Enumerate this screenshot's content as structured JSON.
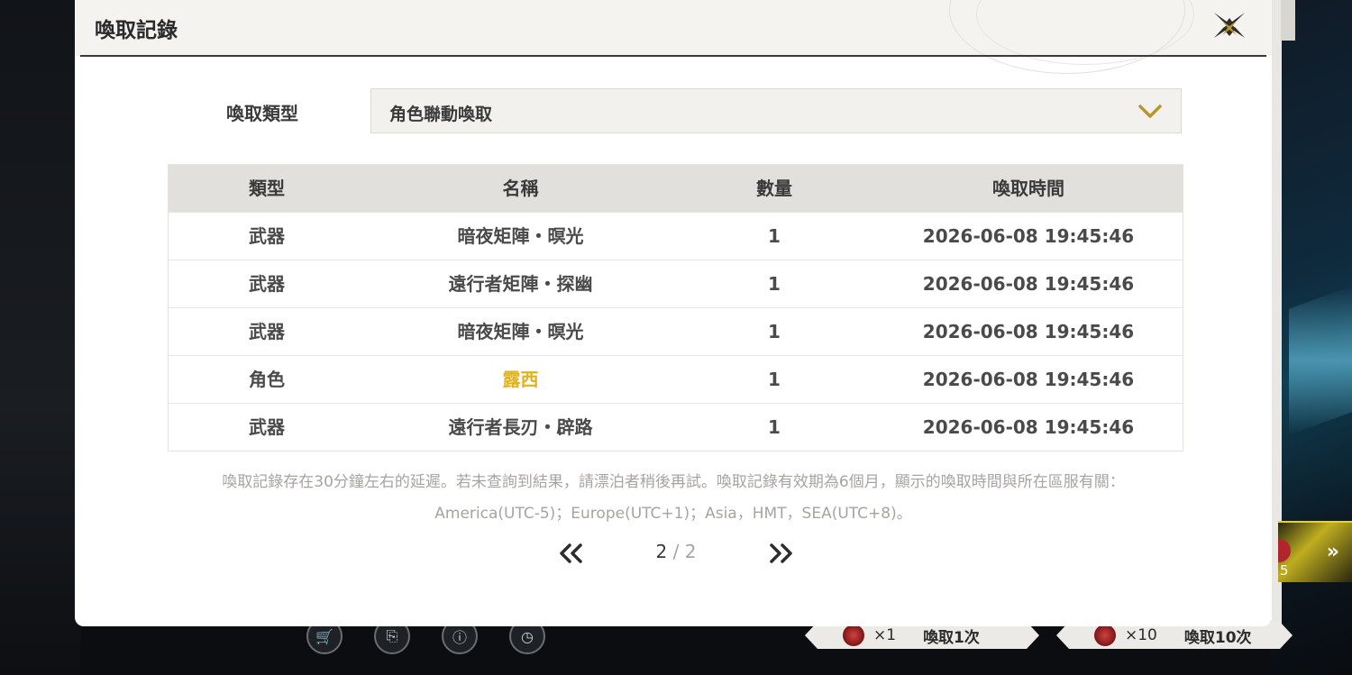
{
  "dialog": {
    "title": "喚取記錄",
    "filter_label": "喚取類型",
    "filter_value": "角色聯動喚取"
  },
  "table": {
    "headers": [
      "類型",
      "名稱",
      "數量",
      "喚取時間"
    ],
    "rows": [
      {
        "type": "武器",
        "name": "暗夜矩陣・暝光",
        "qty": "1",
        "time": "2026-06-08 19:45:46"
      },
      {
        "type": "武器",
        "name": "遠行者矩陣・探幽",
        "qty": "1",
        "time": "2026-06-08 19:45:46"
      },
      {
        "type": "武器",
        "name": "暗夜矩陣・暝光",
        "qty": "1",
        "time": "2026-06-08 19:45:46"
      },
      {
        "type": "角色",
        "name": "露西",
        "qty": "1",
        "time": "2026-06-08 19:45:46"
      },
      {
        "type": "武器",
        "name": "遠行者長刃・辟路",
        "qty": "1",
        "time": "2026-06-08 19:45:46"
      }
    ]
  },
  "notes": {
    "line1": "喚取記錄存在30分鐘左右的延遲。若未查詢到結果，請漂泊者稍後再試。喚取記錄有效期為6個月，顯示的喚取時間與所在區服有關：",
    "line2": "America(UTC-5)；Europe(UTC+1)；Asia，HMT，SEA(UTC+8)。"
  },
  "pager": {
    "current": "2",
    "separator": "/",
    "total": "2"
  },
  "background": {
    "side_count": "5",
    "pull_one": {
      "mult": "×1",
      "label": "喚取1次"
    },
    "pull_ten": {
      "mult": "×10",
      "label": "喚取10次"
    }
  },
  "colors": {
    "accent": "#e1b21a",
    "chevron": "#b8962e",
    "header_bg": "#f4f3f0"
  },
  "icons": {
    "close": "close-x-icon",
    "dropdown": "chevron-down-icon",
    "prev": "double-chevron-left-icon",
    "next": "double-chevron-right-icon",
    "shop": "cart-icon",
    "details": "document-search-icon",
    "info": "info-icon",
    "history": "clock-icon"
  }
}
